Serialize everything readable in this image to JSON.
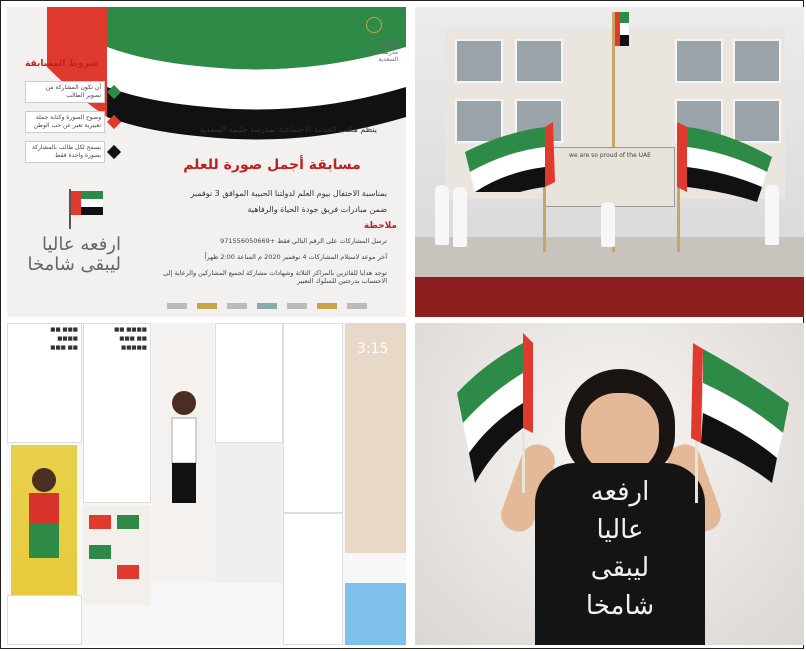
{
  "colors": {
    "red": "#e03a2f",
    "green": "#2e8b47",
    "black": "#111111",
    "white": "#ffffff",
    "gold": "#c9a24c"
  },
  "panel1": {
    "ministry": "وزارة التربية والتعليم",
    "school": "مدرسة حليمة السعدية",
    "conditions_title": "شروط المسابقة",
    "conditions": [
      "أن تكون المشاركة من تصوير الطالب",
      "وضوح الصورة وكتابة جملة تعبيرية تعبر عن حب الوطن",
      "يسمح لكل طالب بالمشاركة بصورة واحدة فقط"
    ],
    "intro": "ينظم مكتب الخدمة الاجتماعية بمدرسة حليمة السعدية",
    "title": "مسابقة أجمل صورة للعلم",
    "occasion": "بمناسبة الاحتفال بيوم العلم لدولتنا الحبيبة الموافق 3 نوفمبر",
    "initiative": "ضمن مبادرات فريق جودة الحياة والرفاهية",
    "notes_title": "ملاحظة",
    "notes": [
      "ترسل المشاركات على الرقم التالي فقط +971556050669",
      "آخر موعد لاستلام المشاركات 4 نوفمبر 2020 م الساعة 2:00 ظهراً",
      "توجد هدايا للفائزين بالمراكز الثلاثة وشهادات مشاركة لجميع المشاركين والرعاية إلى الاحتساب بدرجتين للسلوك التعبير"
    ],
    "calligraphy": [
      "ارفعه عاليا",
      "ليبقى شامخا"
    ]
  },
  "panel2": {
    "banner_text": "we are so proud of the UAE"
  },
  "panel3": {
    "clock": "3:15"
  },
  "panel4": {
    "shirt_lines": [
      "ارفعه",
      "عاليا",
      "ليبقى",
      "شامخا"
    ]
  }
}
